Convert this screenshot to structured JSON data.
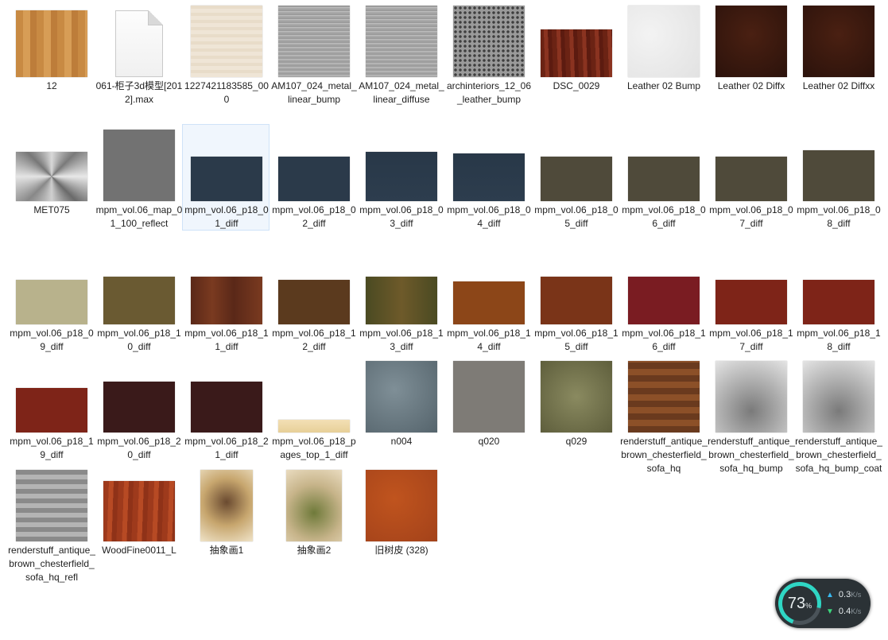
{
  "files": [
    {
      "name": "12",
      "tex": "wood",
      "h": 84
    },
    {
      "name": "061-柜子3d模型[2012].max",
      "tex": "file",
      "h": 84
    },
    {
      "name": "1227421183585_000",
      "tex": "cream",
      "h": 90
    },
    {
      "name": "AM107_024_metal_linear_bump",
      "tex": "metal",
      "h": 90
    },
    {
      "name": "AM107_024_metal_linear_diffuse",
      "tex": "metal",
      "h": 90
    },
    {
      "name": "archinteriors_12_06_leather_bump",
      "tex": "leatherbump",
      "h": 90
    },
    {
      "name": "DSC_0029",
      "tex": "redwood",
      "h": 60
    },
    {
      "name": "Leather 02 Bump",
      "tex": "white",
      "h": 90
    },
    {
      "name": "Leather 02 Diffx",
      "tex": "brown",
      "h": 90
    },
    {
      "name": "Leather 02 Diffxx",
      "tex": "brown",
      "h": 90
    },
    {
      "name": "MET075",
      "tex": "radial",
      "h": 62
    },
    {
      "name": "mpm_vol.06_map_01_100_reflect",
      "tex": "gray",
      "h": 90
    },
    {
      "name": "mpm_vol.06_p18_01_diff",
      "tex": "navy",
      "h": 56,
      "selected": true
    },
    {
      "name": "mpm_vol.06_p18_02_diff",
      "tex": "navy",
      "h": 56
    },
    {
      "name": "mpm_vol.06_p18_03_diff",
      "tex": "navy2",
      "h": 62
    },
    {
      "name": "mpm_vol.06_p18_04_diff",
      "tex": "navy2",
      "h": 60
    },
    {
      "name": "mpm_vol.06_p18_05_diff",
      "tex": "olive",
      "h": 56
    },
    {
      "name": "mpm_vol.06_p18_06_diff",
      "tex": "olive",
      "h": 56
    },
    {
      "name": "mpm_vol.06_p18_07_diff",
      "tex": "olive",
      "h": 56
    },
    {
      "name": "mpm_vol.06_p18_08_diff",
      "tex": "olive",
      "h": 64
    },
    {
      "name": "mpm_vol.06_p18_09_diff",
      "tex": "khaki",
      "h": 56
    },
    {
      "name": "mpm_vol.06_p18_10_diff",
      "tex": "olive2",
      "h": 60
    },
    {
      "name": "mpm_vol.06_p18_11_diff",
      "tex": "book",
      "h": 60
    },
    {
      "name": "mpm_vol.06_p18_12_diff",
      "tex": "brown2",
      "h": 56
    },
    {
      "name": "mpm_vol.06_p18_13_diff",
      "tex": "green",
      "h": 60
    },
    {
      "name": "mpm_vol.06_p18_14_diff",
      "tex": "orange",
      "h": 54
    },
    {
      "name": "mpm_vol.06_p18_15_diff",
      "tex": "rust",
      "h": 60
    },
    {
      "name": "mpm_vol.06_p18_16_diff",
      "tex": "crimson",
      "h": 60
    },
    {
      "name": "mpm_vol.06_p18_17_diff",
      "tex": "red",
      "h": 56
    },
    {
      "name": "mpm_vol.06_p18_18_diff",
      "tex": "red",
      "h": 56
    },
    {
      "name": "mpm_vol.06_p18_19_diff",
      "tex": "red",
      "h": 56
    },
    {
      "name": "mpm_vol.06_p18_20_diff",
      "tex": "dred",
      "h": 64
    },
    {
      "name": "mpm_vol.06_p18_21_diff",
      "tex": "dred",
      "h": 64
    },
    {
      "name": "mpm_vol.06_p18_pages_top_1_diff",
      "tex": "pages",
      "h": 16
    },
    {
      "name": "n004",
      "tex": "stone",
      "h": 90
    },
    {
      "name": "q020",
      "tex": "gstone",
      "h": 90
    },
    {
      "name": "q029",
      "tex": "moss",
      "h": 90
    },
    {
      "name": "renderstuff_antique_brown_chesterfield_sofa_hq",
      "tex": "sofa",
      "h": 90
    },
    {
      "name": "renderstuff_antique_brown_chesterfield_sofa_hq_bump",
      "tex": "sofagray",
      "h": 90
    },
    {
      "name": "renderstuff_antique_brown_chesterfield_sofa_hq_bump_coat",
      "tex": "sofagray",
      "h": 90
    },
    {
      "name": "renderstuff_antique_brown_chesterfield_sofa_hq_refl",
      "tex": "sofarefl",
      "h": 90
    },
    {
      "name": "WoodFine0011_L",
      "tex": "woodfine",
      "h": 76
    },
    {
      "name": "抽象画1",
      "tex": "paint1",
      "h": 90,
      "w": 66
    },
    {
      "name": "抽象画2",
      "tex": "paint2",
      "h": 90,
      "w": 70
    },
    {
      "name": "旧树皮 (328)",
      "tex": "leather",
      "h": 90
    }
  ],
  "gadget": {
    "percent": "73",
    "percent_unit": "%",
    "upload": "0.3",
    "download": "0.4",
    "unit": "K/s",
    "up_icon": "arrow-up-icon",
    "down_icon": "arrow-down-icon",
    "accent_color": "#2fd6c4",
    "value": 0.73
  }
}
